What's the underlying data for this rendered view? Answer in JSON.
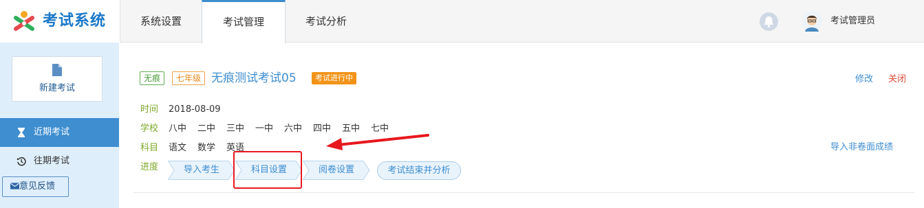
{
  "header": {
    "logo_text": "考试系统",
    "tabs": [
      {
        "label": "系统设置"
      },
      {
        "label": "考试管理"
      },
      {
        "label": "考试分析"
      }
    ],
    "active_tab": "考试管理",
    "username": "考试管理员"
  },
  "sidebar": {
    "new_exam_label": "新建考试",
    "items": [
      {
        "label": "近期考试"
      },
      {
        "label": "往期考试"
      }
    ],
    "feedback_label": "意见反馈"
  },
  "exam": {
    "badges": [
      "无痕",
      "七年级"
    ],
    "title": "无痕测试考试05",
    "status": "考试进行中",
    "edit_label": "修改",
    "close_label": "关闭",
    "time_label": "时间",
    "time_value": "2018-08-09",
    "school_label": "学校",
    "schools": [
      "八中",
      "二中",
      "三中",
      "一中",
      "六中",
      "四中",
      "五中",
      "七中"
    ],
    "subject_label": "科目",
    "subjects": [
      "语文",
      "数学",
      "英语"
    ],
    "import_link": "导入非卷面成绩",
    "progress_label": "进度",
    "steps": [
      "导入考生",
      "科目设置",
      "阅卷设置"
    ],
    "final_step": "考试结束并分析"
  },
  "colors": {
    "accent": "#3e8ed0",
    "sidebar_bg": "#dfeefb",
    "status_orange": "#f29317",
    "label_green": "#7ea828",
    "highlight_red": "#e8171e"
  }
}
